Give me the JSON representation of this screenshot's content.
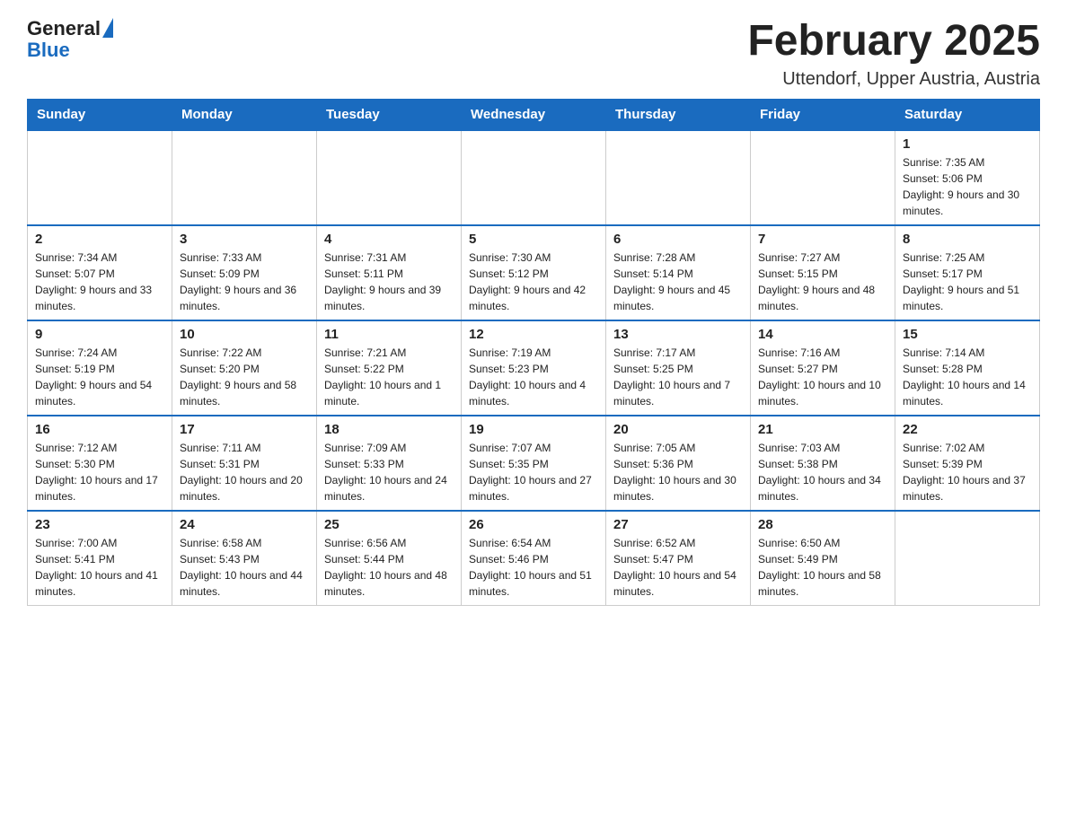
{
  "header": {
    "logo": {
      "text_general": "General",
      "text_blue": "Blue",
      "aria_label": "GeneralBlue logo"
    },
    "month_title": "February 2025",
    "location": "Uttendorf, Upper Austria, Austria"
  },
  "calendar": {
    "weekdays": [
      "Sunday",
      "Monday",
      "Tuesday",
      "Wednesday",
      "Thursday",
      "Friday",
      "Saturday"
    ],
    "weeks": [
      [
        {
          "day": "",
          "info": ""
        },
        {
          "day": "",
          "info": ""
        },
        {
          "day": "",
          "info": ""
        },
        {
          "day": "",
          "info": ""
        },
        {
          "day": "",
          "info": ""
        },
        {
          "day": "",
          "info": ""
        },
        {
          "day": "1",
          "info": "Sunrise: 7:35 AM\nSunset: 5:06 PM\nDaylight: 9 hours and 30 minutes."
        }
      ],
      [
        {
          "day": "2",
          "info": "Sunrise: 7:34 AM\nSunset: 5:07 PM\nDaylight: 9 hours and 33 minutes."
        },
        {
          "day": "3",
          "info": "Sunrise: 7:33 AM\nSunset: 5:09 PM\nDaylight: 9 hours and 36 minutes."
        },
        {
          "day": "4",
          "info": "Sunrise: 7:31 AM\nSunset: 5:11 PM\nDaylight: 9 hours and 39 minutes."
        },
        {
          "day": "5",
          "info": "Sunrise: 7:30 AM\nSunset: 5:12 PM\nDaylight: 9 hours and 42 minutes."
        },
        {
          "day": "6",
          "info": "Sunrise: 7:28 AM\nSunset: 5:14 PM\nDaylight: 9 hours and 45 minutes."
        },
        {
          "day": "7",
          "info": "Sunrise: 7:27 AM\nSunset: 5:15 PM\nDaylight: 9 hours and 48 minutes."
        },
        {
          "day": "8",
          "info": "Sunrise: 7:25 AM\nSunset: 5:17 PM\nDaylight: 9 hours and 51 minutes."
        }
      ],
      [
        {
          "day": "9",
          "info": "Sunrise: 7:24 AM\nSunset: 5:19 PM\nDaylight: 9 hours and 54 minutes."
        },
        {
          "day": "10",
          "info": "Sunrise: 7:22 AM\nSunset: 5:20 PM\nDaylight: 9 hours and 58 minutes."
        },
        {
          "day": "11",
          "info": "Sunrise: 7:21 AM\nSunset: 5:22 PM\nDaylight: 10 hours and 1 minute."
        },
        {
          "day": "12",
          "info": "Sunrise: 7:19 AM\nSunset: 5:23 PM\nDaylight: 10 hours and 4 minutes."
        },
        {
          "day": "13",
          "info": "Sunrise: 7:17 AM\nSunset: 5:25 PM\nDaylight: 10 hours and 7 minutes."
        },
        {
          "day": "14",
          "info": "Sunrise: 7:16 AM\nSunset: 5:27 PM\nDaylight: 10 hours and 10 minutes."
        },
        {
          "day": "15",
          "info": "Sunrise: 7:14 AM\nSunset: 5:28 PM\nDaylight: 10 hours and 14 minutes."
        }
      ],
      [
        {
          "day": "16",
          "info": "Sunrise: 7:12 AM\nSunset: 5:30 PM\nDaylight: 10 hours and 17 minutes."
        },
        {
          "day": "17",
          "info": "Sunrise: 7:11 AM\nSunset: 5:31 PM\nDaylight: 10 hours and 20 minutes."
        },
        {
          "day": "18",
          "info": "Sunrise: 7:09 AM\nSunset: 5:33 PM\nDaylight: 10 hours and 24 minutes."
        },
        {
          "day": "19",
          "info": "Sunrise: 7:07 AM\nSunset: 5:35 PM\nDaylight: 10 hours and 27 minutes."
        },
        {
          "day": "20",
          "info": "Sunrise: 7:05 AM\nSunset: 5:36 PM\nDaylight: 10 hours and 30 minutes."
        },
        {
          "day": "21",
          "info": "Sunrise: 7:03 AM\nSunset: 5:38 PM\nDaylight: 10 hours and 34 minutes."
        },
        {
          "day": "22",
          "info": "Sunrise: 7:02 AM\nSunset: 5:39 PM\nDaylight: 10 hours and 37 minutes."
        }
      ],
      [
        {
          "day": "23",
          "info": "Sunrise: 7:00 AM\nSunset: 5:41 PM\nDaylight: 10 hours and 41 minutes."
        },
        {
          "day": "24",
          "info": "Sunrise: 6:58 AM\nSunset: 5:43 PM\nDaylight: 10 hours and 44 minutes."
        },
        {
          "day": "25",
          "info": "Sunrise: 6:56 AM\nSunset: 5:44 PM\nDaylight: 10 hours and 48 minutes."
        },
        {
          "day": "26",
          "info": "Sunrise: 6:54 AM\nSunset: 5:46 PM\nDaylight: 10 hours and 51 minutes."
        },
        {
          "day": "27",
          "info": "Sunrise: 6:52 AM\nSunset: 5:47 PM\nDaylight: 10 hours and 54 minutes."
        },
        {
          "day": "28",
          "info": "Sunrise: 6:50 AM\nSunset: 5:49 PM\nDaylight: 10 hours and 58 minutes."
        },
        {
          "day": "",
          "info": ""
        }
      ]
    ]
  }
}
